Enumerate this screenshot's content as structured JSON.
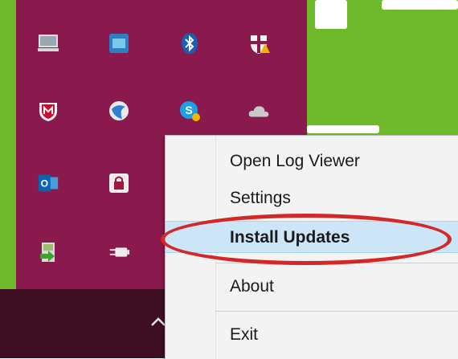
{
  "menu": {
    "items": [
      {
        "label": "Open Log Viewer"
      },
      {
        "label": "Settings"
      },
      {
        "label": "Install Updates"
      },
      {
        "label": "About"
      },
      {
        "label": "Exit"
      }
    ]
  },
  "tray": {
    "icons": [
      "laptop-icon",
      "intel-graphics-icon",
      "bluetooth-icon",
      "security-shield-icon",
      "mcafee-icon",
      "network-globe-icon",
      "skype-icon",
      "onedrive-cloud-icon",
      "outlook-icon",
      "lock-icon",
      "safely-remove-hardware-icon",
      "power-plug-icon"
    ],
    "chevron": "^"
  },
  "colors": {
    "tray_bg": "#8a1a4e",
    "taskbar_bg": "#3e0f23",
    "desktop_bg": "#6fba2c",
    "menu_highlight": "#cde6f7",
    "annotation_red": "#d42727"
  }
}
